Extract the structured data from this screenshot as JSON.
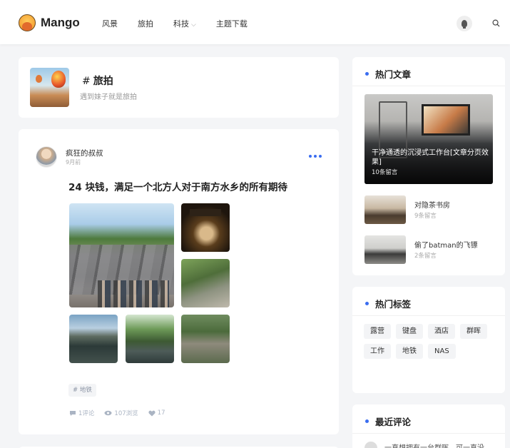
{
  "header": {
    "brand": "Mango",
    "nav": [
      "风景",
      "旅拍",
      "科技",
      "主题下载"
    ],
    "nav_caret": "⌵"
  },
  "category": {
    "hash": "#",
    "title": "旅拍",
    "subtitle": "遇到妹子就是旅拍"
  },
  "post": {
    "author": "疯狂的叔叔",
    "time": "9月前",
    "title": "24 块钱，满足一个北方人对于南方水乡的所有期待",
    "tag": "# 地铁",
    "stats": {
      "comments": "1评论",
      "views": "107浏览",
      "likes": "17"
    }
  },
  "sidebar": {
    "hot_articles": {
      "title": "热门文章",
      "featured": {
        "title": "干净通透的沉浸式工作台[文章分页效果]",
        "comments": "10条留言"
      },
      "items": [
        {
          "title": "对隐茶书房",
          "comments": "9条留言"
        },
        {
          "title": "偷了batman的飞镖",
          "comments": "2条留言"
        }
      ]
    },
    "hot_tags": {
      "title": "热门标签",
      "tags": [
        "露营",
        "键盘",
        "酒店",
        "群晖",
        "工作",
        "地铁",
        "NAS"
      ]
    },
    "recent_comments": {
      "title": "最近评论",
      "first_comment": "一直想拥有一台群晖，可一直没"
    }
  },
  "colors": {
    "accent": "#3a6df0",
    "background": "#f4f5f7"
  }
}
